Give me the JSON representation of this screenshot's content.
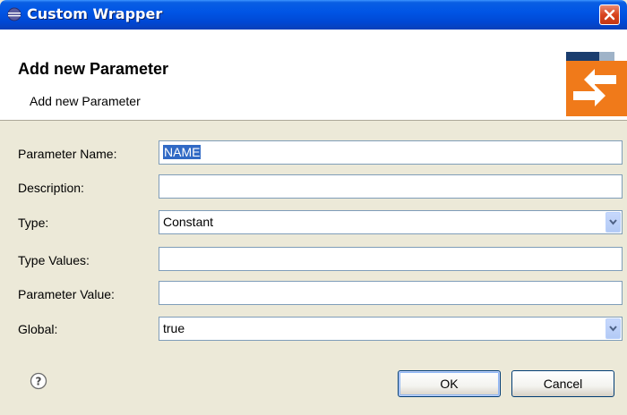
{
  "window": {
    "title": "Custom Wrapper"
  },
  "banner": {
    "title": "Add new Parameter",
    "description": "Add new Parameter"
  },
  "form": {
    "parameter_name": {
      "label": "Parameter Name:",
      "value": "NAME"
    },
    "description": {
      "label": "Description:",
      "value": ""
    },
    "type": {
      "label": "Type:",
      "value": "Constant"
    },
    "type_values": {
      "label": "Type Values:",
      "value": ""
    },
    "parameter_value": {
      "label": "Parameter Value:",
      "value": ""
    },
    "global": {
      "label": "Global:",
      "value": "true"
    }
  },
  "footer": {
    "ok_label": "OK",
    "cancel_label": "Cancel"
  },
  "icons": {
    "app": "eclipse-icon",
    "close": "close-icon",
    "banner": "wizard-arrows-icon",
    "help": "help-icon",
    "dropdown": "chevron-down-icon"
  },
  "colors": {
    "titlebar": "#0055E5",
    "close": "#D8431E",
    "selection": "#316AC5",
    "banner_accent": "#F07A1A"
  }
}
